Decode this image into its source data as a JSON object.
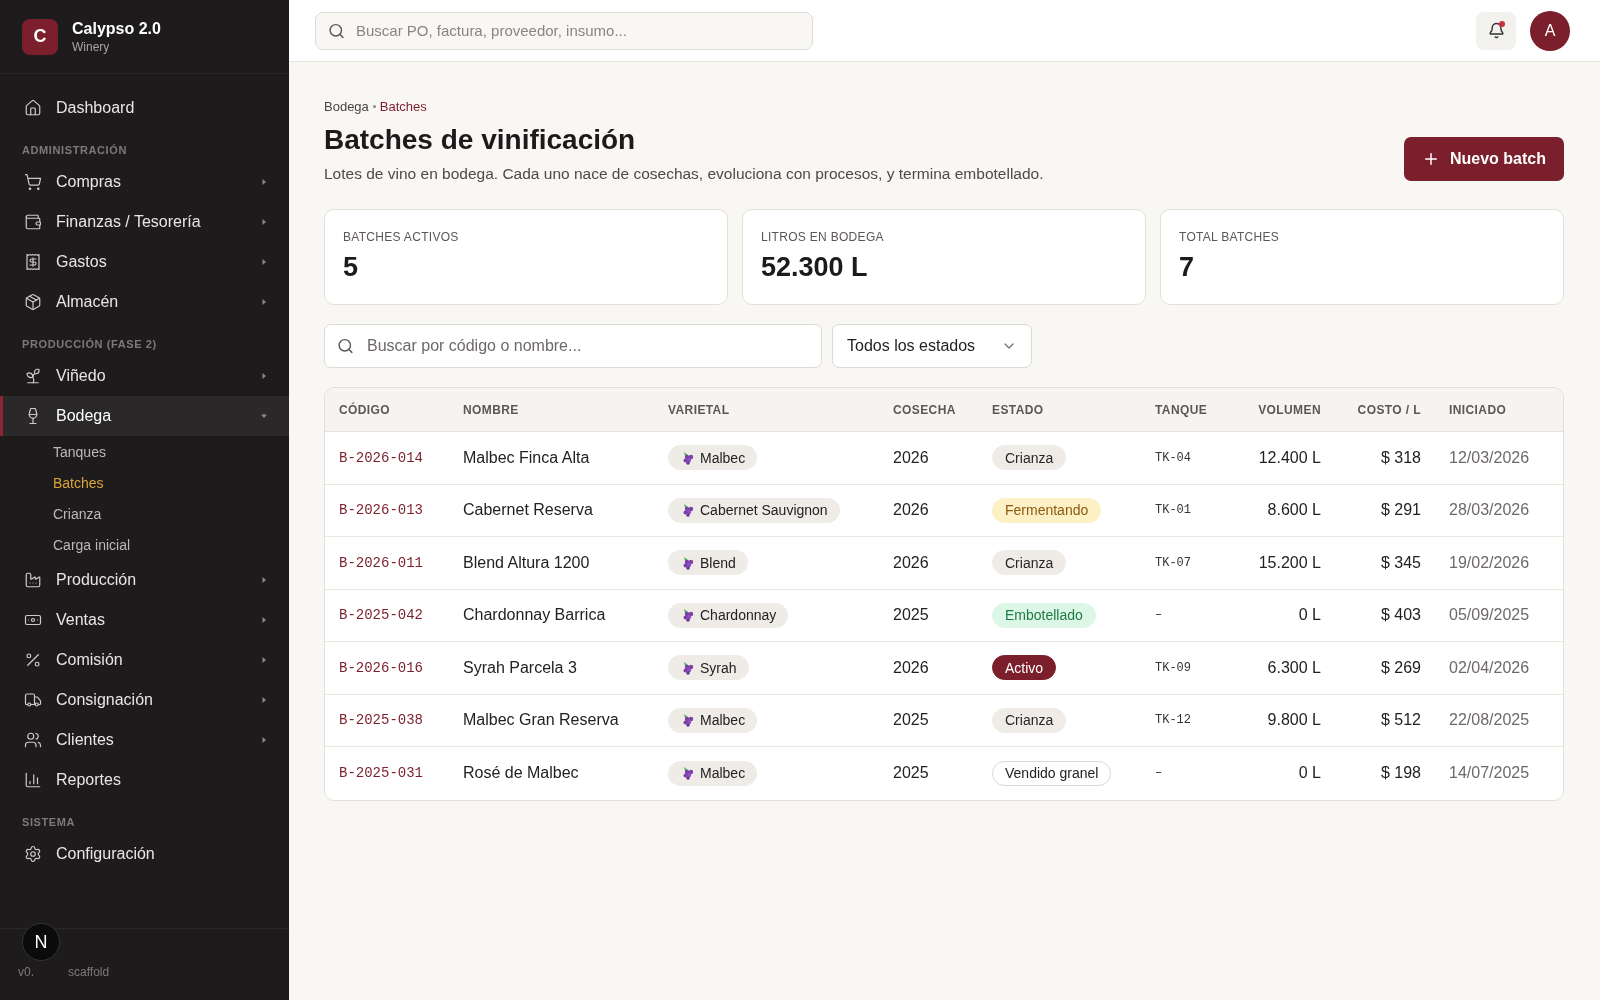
{
  "brand": {
    "logo_letter": "C",
    "name": "Calypso 2.0",
    "subtitle": "Winery"
  },
  "sidebar": {
    "sections": [
      {
        "items": [
          {
            "label": "Dashboard",
            "selected": false
          }
        ]
      },
      {
        "title": "ADMINISTRACIÓN",
        "items": [
          {
            "label": "Compras",
            "selected": false,
            "expanded": false
          },
          {
            "label": "Finanzas / Tesorería",
            "selected": false,
            "expanded": false
          },
          {
            "label": "Gastos",
            "selected": false,
            "expanded": false
          },
          {
            "label": "Almacén",
            "selected": false,
            "expanded": false
          }
        ]
      },
      {
        "title": "PRODUCCIÓN (FASE 2)",
        "items": [
          {
            "label": "Viñedo",
            "selected": false,
            "expanded": false
          },
          {
            "label": "Bodega",
            "selected": true,
            "expanded": true,
            "children": [
              {
                "label": "Tanques",
                "selected": false
              },
              {
                "label": "Batches",
                "selected": true
              },
              {
                "label": "Crianza",
                "selected": false
              },
              {
                "label": "Carga inicial",
                "selected": false
              }
            ]
          },
          {
            "label": "Producción",
            "selected": false,
            "expanded": false
          },
          {
            "label": "Ventas",
            "selected": false,
            "expanded": false
          },
          {
            "label": "Comisión",
            "selected": false,
            "expanded": false
          },
          {
            "label": "Consignación",
            "selected": false,
            "expanded": false
          },
          {
            "label": "Clientes",
            "selected": false,
            "expanded": false
          },
          {
            "label": "Reportes",
            "selected": false
          }
        ]
      },
      {
        "title": "SISTEMA",
        "items": [
          {
            "label": "Configuración",
            "selected": false
          }
        ]
      }
    ],
    "footer": {
      "version": "v0.",
      "note": "scaffold",
      "badge": "N"
    }
  },
  "topbar": {
    "search": {
      "placeholder": "Buscar PO, factura, proveedor, insumo..."
    },
    "avatar": "A",
    "notification": true
  },
  "breadcrumb": [
    {
      "label": "Bodega",
      "selected": false
    },
    {
      "label": "Batches",
      "selected": true
    }
  ],
  "page": {
    "title": "Batches de vinificación",
    "subtitle": "Lotes de vino en bodega. Cada uno nace de cosechas, evoluciona con procesos, y termina embotellado.",
    "action": "Nuevo batch"
  },
  "stats": [
    {
      "label": "BATCHES ACTIVOS",
      "value": "5"
    },
    {
      "label": "LITROS EN BODEGA",
      "value": "52.300 L"
    },
    {
      "label": "TOTAL BATCHES",
      "value": "7"
    }
  ],
  "filters": {
    "search": {
      "placeholder": "Buscar por código o nombre..."
    },
    "status_select": "Todos los estados"
  },
  "table": {
    "columns": [
      "CÓDIGO",
      "NOMBRE",
      "VARIETAL",
      "COSECHA",
      "ESTADO",
      "TANQUE",
      "VOLUMEN",
      "COSTO / L",
      "INICIADO"
    ],
    "rows": [
      {
        "code": "B-2026-014",
        "name": "Malbec Finca Alta",
        "varietal": "Malbec",
        "harvest": "2026",
        "status": {
          "label": "Crianza",
          "kind": "aging"
        },
        "tank": "TK-04",
        "volume": "12.400 L",
        "cost": "$ 318",
        "started": "12/03/2026"
      },
      {
        "code": "B-2026-013",
        "name": "Cabernet Reserva",
        "varietal": "Cabernet Sauvignon",
        "harvest": "2026",
        "status": {
          "label": "Fermentando",
          "kind": "fermenting"
        },
        "tank": "TK-01",
        "volume": "8.600 L",
        "cost": "$ 291",
        "started": "28/03/2026"
      },
      {
        "code": "B-2026-011",
        "name": "Blend Altura 1200",
        "varietal": "Blend",
        "harvest": "2026",
        "status": {
          "label": "Crianza",
          "kind": "aging"
        },
        "tank": "TK-07",
        "volume": "15.200 L",
        "cost": "$ 345",
        "started": "19/02/2026"
      },
      {
        "code": "B-2025-042",
        "name": "Chardonnay Barrica",
        "varietal": "Chardonnay",
        "harvest": "2025",
        "status": {
          "label": "Embotellado",
          "kind": "bottled"
        },
        "tank": "–",
        "volume": "0 L",
        "cost": "$ 403",
        "started": "05/09/2025"
      },
      {
        "code": "B-2026-016",
        "name": "Syrah Parcela 3",
        "varietal": "Syrah",
        "harvest": "2026",
        "status": {
          "label": "Activo",
          "kind": "active"
        },
        "tank": "TK-09",
        "volume": "6.300 L",
        "cost": "$ 269",
        "started": "02/04/2026"
      },
      {
        "code": "B-2025-038",
        "name": "Malbec Gran Reserva",
        "varietal": "Malbec",
        "harvest": "2025",
        "status": {
          "label": "Crianza",
          "kind": "aging"
        },
        "tank": "TK-12",
        "volume": "9.800 L",
        "cost": "$ 512",
        "started": "22/08/2025"
      },
      {
        "code": "B-2025-031",
        "name": "Rosé de Malbec",
        "varietal": "Malbec",
        "harvest": "2025",
        "status": {
          "label": "Vendido granel",
          "kind": "sold"
        },
        "tank": "–",
        "volume": "0 L",
        "cost": "$ 198",
        "started": "14/07/2025"
      }
    ]
  }
}
